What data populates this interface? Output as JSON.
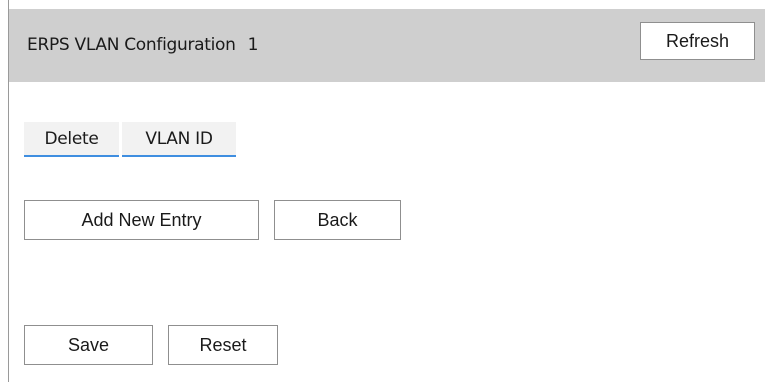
{
  "header": {
    "title": "ERPS VLAN Configuration",
    "ring_id": "1",
    "refresh_label": "Refresh"
  },
  "table": {
    "columns": [
      "Delete",
      "VLAN ID"
    ],
    "rows": []
  },
  "actions": {
    "add_label": "Add New Entry",
    "back_label": "Back",
    "save_label": "Save",
    "reset_label": "Reset"
  },
  "colors": {
    "header_background": "#cfcfcf",
    "column_underline": "#3f8ee0"
  }
}
